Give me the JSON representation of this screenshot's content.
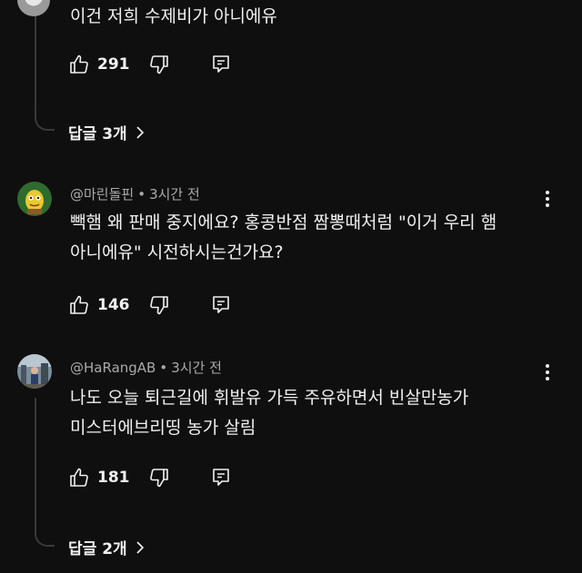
{
  "comments": [
    {
      "id": "c0",
      "author": "",
      "time": "",
      "lines": [
        "이건 저희 수제비가 아니에유"
      ],
      "likes": "291",
      "replies_label": "답글 3개"
    },
    {
      "id": "c1",
      "author": "@마린돌핀",
      "separator": "•",
      "time": "3시간 전",
      "lines": [
        "빽햄 왜 판매 중지에요? 홍콩반점 짬뽕때처럼 \"이거 우리 햄",
        "아니에유\" 시전하시는건가요?"
      ],
      "likes": "146"
    },
    {
      "id": "c2",
      "author": "@HaRangAB",
      "separator": "•",
      "time": "3시간 전",
      "lines": [
        "나도 오늘 퇴근길에 휘발유 가득 주유하면서 빈살만농가",
        "미스터에브리띵 농가 살림"
      ],
      "likes": "181",
      "replies_label": "답글 2개"
    }
  ],
  "icons": {
    "like": "thumb-up-icon",
    "dislike": "thumb-down-icon",
    "reply": "reply-comment-icon",
    "more": "more-vert-icon",
    "chevron": "chevron-right-icon"
  },
  "colors": {
    "background": "#0f0f0f",
    "text": "#f1f1f1",
    "meta": "#aaaaaa",
    "thread": "#3a3a3a"
  }
}
